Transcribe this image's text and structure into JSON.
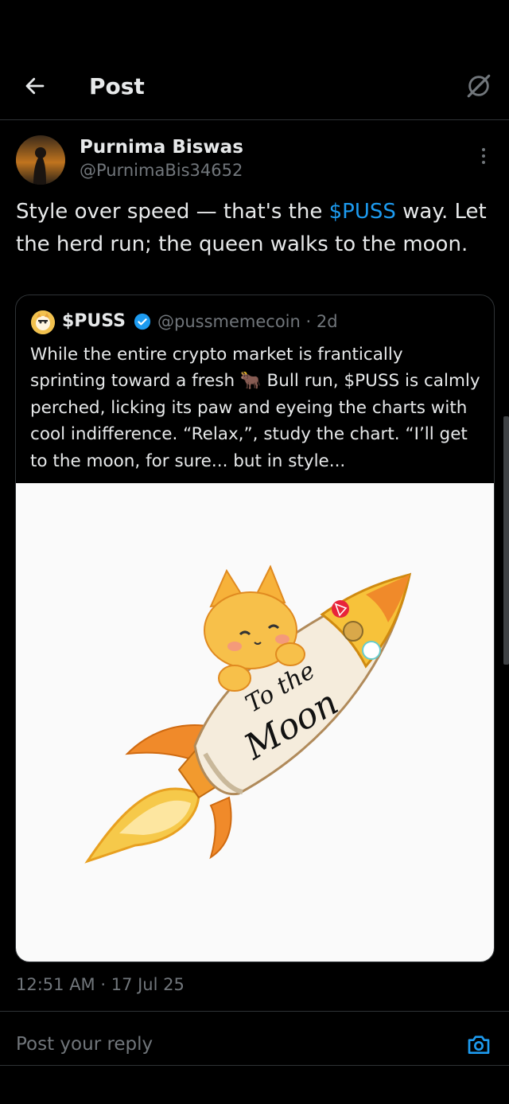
{
  "header": {
    "title": "Post",
    "back_icon": "arrow-left-icon",
    "grok_icon": "grok-icon"
  },
  "post": {
    "author_name": "Purnima Biswas",
    "author_handle": "@PurnimaBis34652",
    "text_part1": "Style over speed — that's the ",
    "cashtag": "$PUSS",
    "text_part2": " way. Let the herd run; the queen walks to the moon.",
    "timestamp": "12:51 AM · 17 Jul 25"
  },
  "quote": {
    "author_name": "$PUSS",
    "author_handle": "@pussmemecoin",
    "age": "· 2d",
    "text_part1": "While the entire crypto market is frantically sprinting toward a fresh ",
    "emoji": "🐂",
    "text_part2": " Bull run, $PUSS is calmly perched, licking its paw and eyeing the charts with cool indifference. “Relax,”, study the chart. “I’ll get to the moon, for sure... but in style...",
    "image_text_line1": "To the",
    "image_text_line2": "Moon"
  },
  "reply": {
    "placeholder": "Post your reply",
    "camera_icon": "camera-icon"
  },
  "colors": {
    "accent": "#1d9bf0",
    "text": "#e7e9ea",
    "muted": "#71767b",
    "border": "#2f3336"
  }
}
